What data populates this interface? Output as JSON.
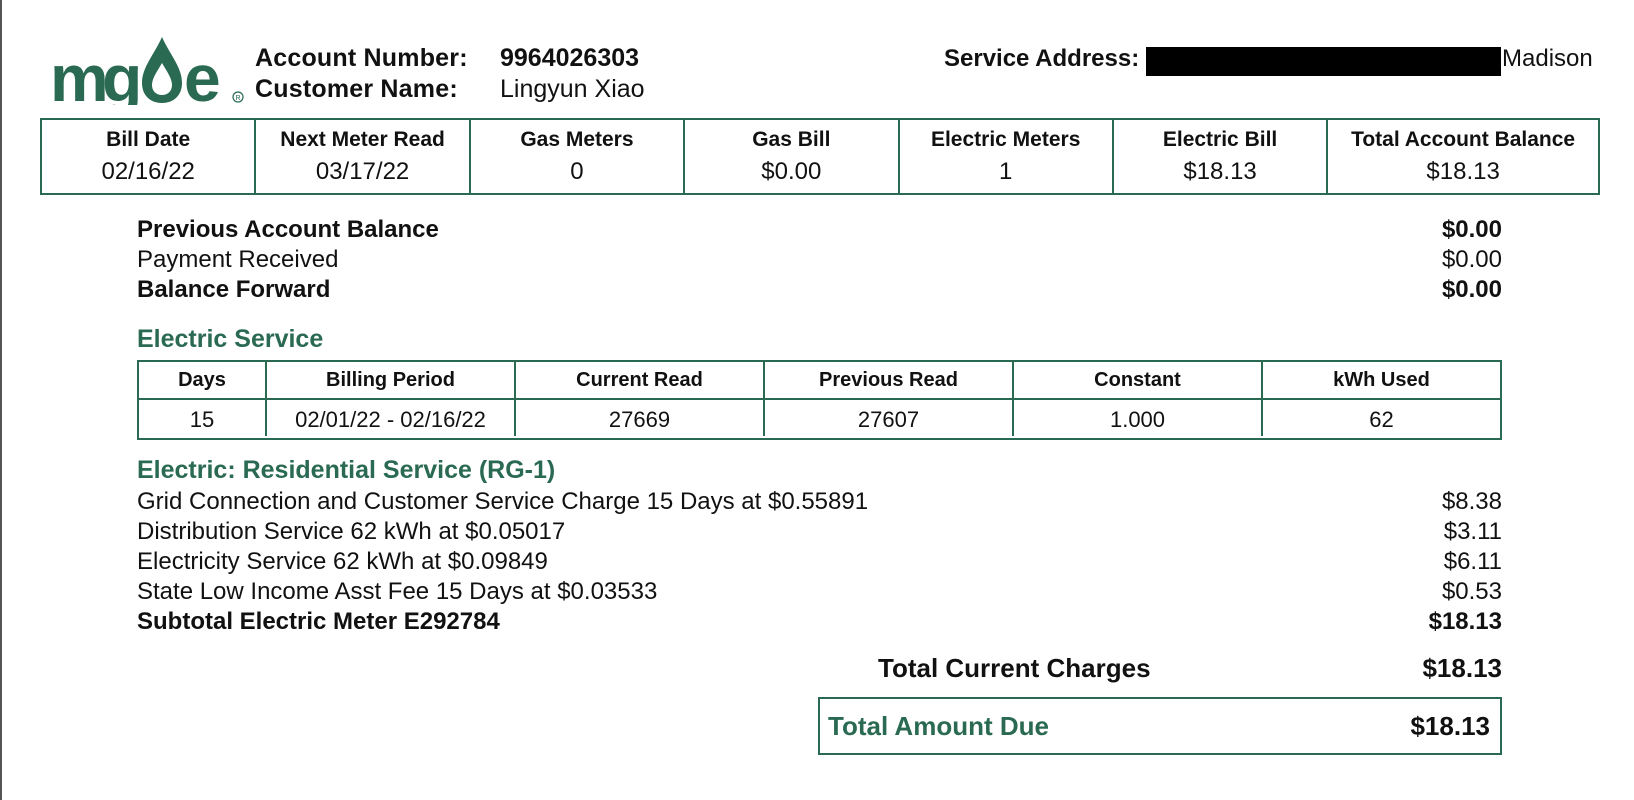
{
  "header": {
    "logo_text": "mge",
    "account_number_label": "Account Number:",
    "account_number": "9964026303",
    "customer_name_label": "Customer Name:",
    "customer_name": "Lingyun Xiao",
    "service_address_label": "Service Address:",
    "service_address_city": "Madison"
  },
  "summary": [
    {
      "label": "Bill Date",
      "value": "02/16/22"
    },
    {
      "label": "Next Meter Read",
      "value": "03/17/22"
    },
    {
      "label": "Gas Meters",
      "value": "0"
    },
    {
      "label": "Gas Bill",
      "value": "$0.00"
    },
    {
      "label": "Electric Meters",
      "value": "1"
    },
    {
      "label": "Electric Bill",
      "value": "$18.13"
    },
    {
      "label": "Total Account Balance",
      "value": "$18.13"
    }
  ],
  "balance": {
    "previous_label": "Previous Account Balance",
    "previous_value": "$0.00",
    "payment_label": "Payment Received",
    "payment_value": "$0.00",
    "forward_label": "Balance Forward",
    "forward_value": "$0.00"
  },
  "electric_service": {
    "title": "Electric Service",
    "headers": [
      "Days",
      "Billing Period",
      "Current Read",
      "Previous Read",
      "Constant",
      "kWh Used"
    ],
    "row": [
      "15",
      "02/01/22 - 02/16/22",
      "27669",
      "27607",
      "1.000",
      "62"
    ]
  },
  "residential": {
    "title": "Electric: Residential Service (RG-1)",
    "lines": [
      {
        "label": "Grid Connection and Customer Service Charge 15 Days at $0.55891",
        "value": "$8.38"
      },
      {
        "label": "Distribution Service 62 kWh at $0.05017",
        "value": "$3.11"
      },
      {
        "label": "Electricity Service 62 kWh at $0.09849",
        "value": "$6.11"
      },
      {
        "label": "State Low Income Asst Fee 15 Days at $0.03533",
        "value": "$0.53"
      }
    ],
    "subtotal_label": "Subtotal Electric Meter E292784",
    "subtotal_value": "$18.13"
  },
  "totals": {
    "current_label": "Total Current Charges",
    "current_value": "$18.13",
    "due_label": "Total Amount Due",
    "due_value": "$18.13"
  },
  "colors": {
    "brand_green": "#2a6a52"
  }
}
